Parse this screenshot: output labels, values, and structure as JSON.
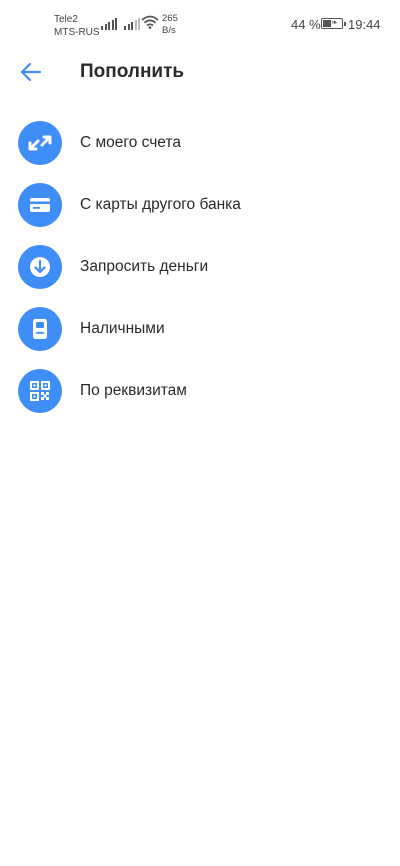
{
  "status_bar": {
    "carrier1": "Tele2",
    "carrier2": "MTS-RUS",
    "speed_value": "265",
    "speed_unit": "B/s",
    "battery_percent": "44 %",
    "battery_level": 0.44,
    "time": "19:44"
  },
  "header": {
    "title": "Пополнить",
    "back_icon": "arrow-left-icon"
  },
  "colors": {
    "accent": "#3f8ef7",
    "text": "#2b2b2b",
    "background": "#ffffff"
  },
  "menu": {
    "items": [
      {
        "label": "С моего счета",
        "icon": "transfer-arrows-icon"
      },
      {
        "label": "С карты другого банка",
        "icon": "credit-card-icon"
      },
      {
        "label": "Запросить деньги",
        "icon": "arrow-down-circle-icon"
      },
      {
        "label": "Наличными",
        "icon": "atm-icon"
      },
      {
        "label": "По реквизитам",
        "icon": "qr-code-icon"
      }
    ]
  }
}
